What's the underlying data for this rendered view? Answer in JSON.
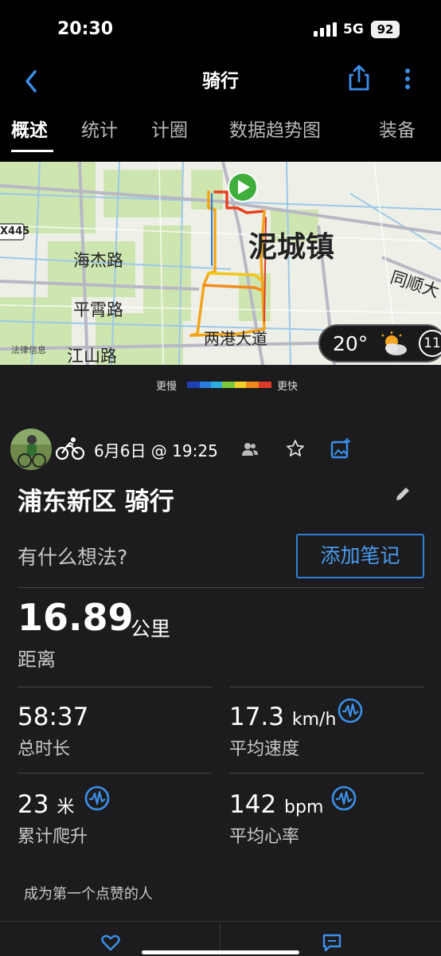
{
  "status_bar": {
    "time": "20:30",
    "network": "5G",
    "battery": "92"
  },
  "nav": {
    "title": "骑行",
    "back_icon": "chevron-left-icon",
    "share_icon": "share-icon",
    "more_icon": "more-vertical-icon"
  },
  "tabs": [
    "概述",
    "统计",
    "计圈",
    "数据趋势图",
    "装备"
  ],
  "map": {
    "labels": [
      "泥城镇",
      "海杰路",
      "平霄路",
      "江山路",
      "两港大道",
      "同顺大",
      "X445",
      "法律信息"
    ],
    "weather_temp": "20°",
    "weather_badge": "11"
  },
  "legend": {
    "slow": "更慢",
    "fast": "更快",
    "gradient_colors": [
      "#1f3fb5",
      "#2a7de0",
      "#2ab0e0",
      "#7ec83a",
      "#f2d02a",
      "#f28a1a",
      "#e03a2a"
    ]
  },
  "activity": {
    "date": "6月6日 @ 19:25",
    "title": "浦东新区 骑行",
    "thought_prompt": "有什么想法?",
    "add_note_label": "添加笔记"
  },
  "stats": {
    "distance": {
      "value": "16.89",
      "unit": "公里",
      "label": "距离"
    },
    "duration": {
      "value": "58:37",
      "unit": "",
      "label": "总时长"
    },
    "avg_speed": {
      "value": "17.3",
      "unit": "km/h",
      "label": "平均速度"
    },
    "elevation": {
      "value": "23",
      "unit": "米",
      "label": "累计爬升"
    },
    "avg_hr": {
      "value": "142",
      "unit": "bpm",
      "label": "平均心率"
    }
  },
  "likes": {
    "text": "成为第一个点赞的人"
  },
  "accent_color": "#2f7fd8"
}
